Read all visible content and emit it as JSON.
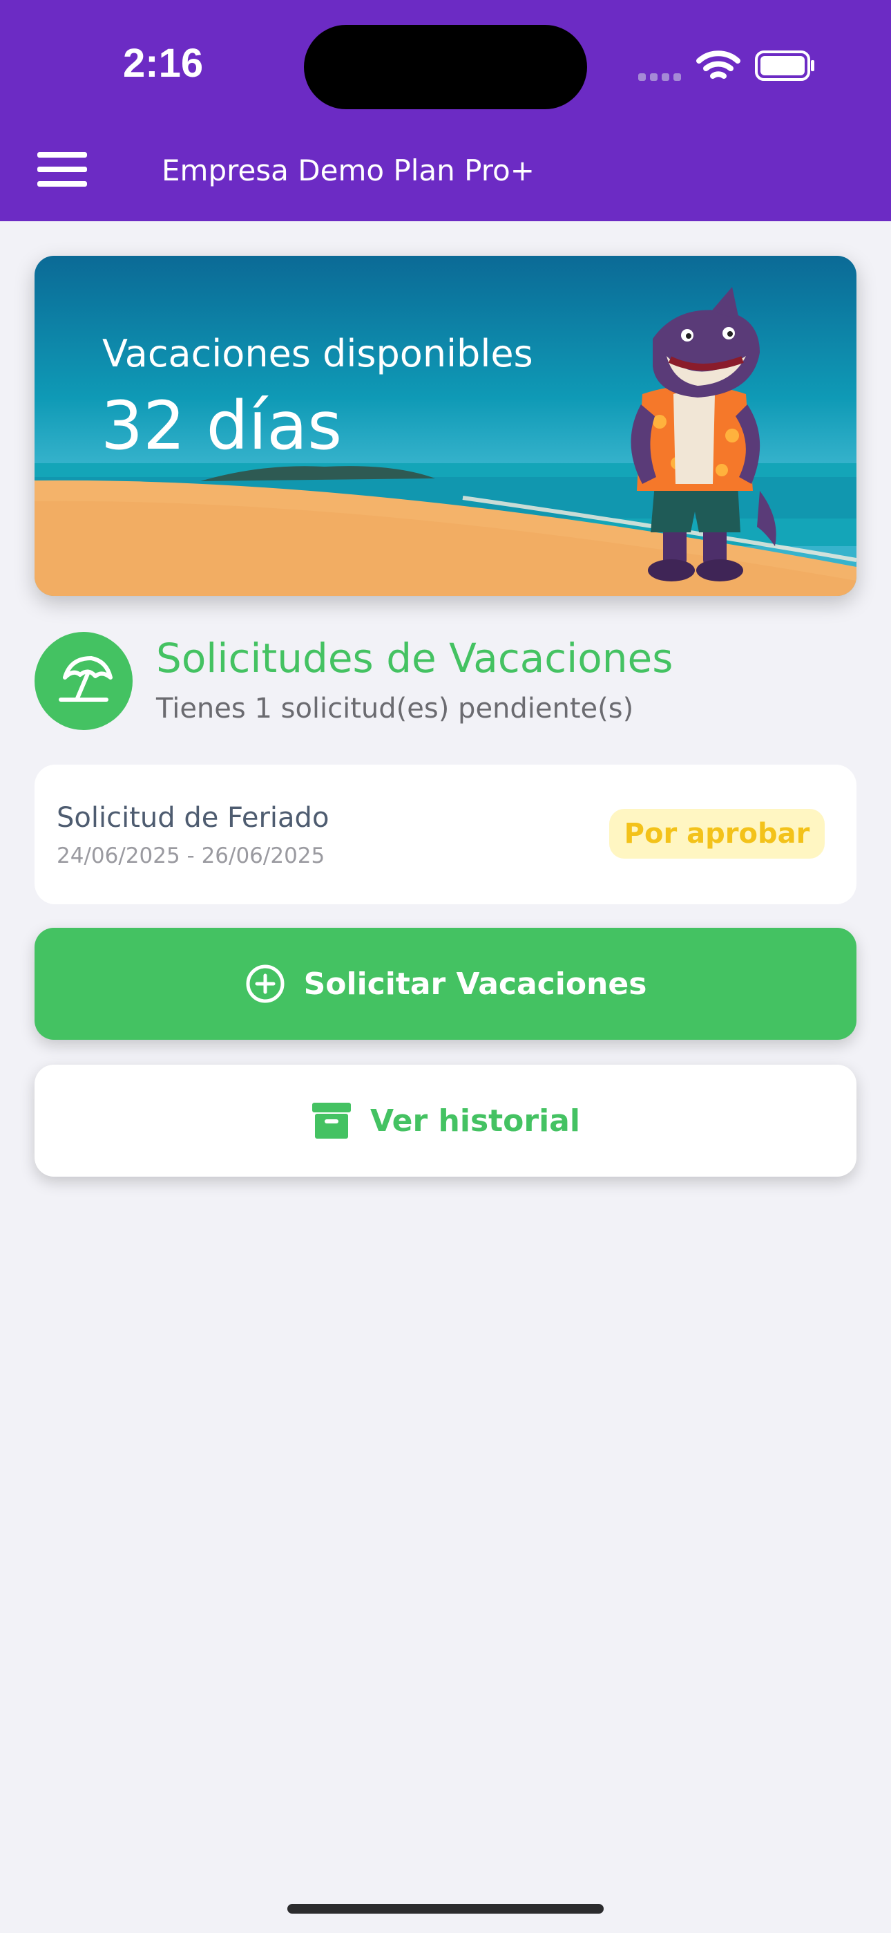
{
  "status_bar": {
    "time": "2:16",
    "icons": [
      "signal-icon",
      "wifi-icon",
      "battery-icon"
    ]
  },
  "header": {
    "menu_icon": "hamburger-menu-icon",
    "title": "Empresa Demo Plan Pro+",
    "background_color": "#6c2bc4"
  },
  "hero": {
    "label": "Vacaciones disponibles",
    "value": "32 días",
    "image": "beach-with-shark-mascot-illustration"
  },
  "section": {
    "icon": "beach-umbrella-icon",
    "title": "Solicitudes de Vacaciones",
    "subtitle": "Tienes 1 solicitud(es) pendiente(s)"
  },
  "requests": [
    {
      "title": "Solicitud de Feriado",
      "dates": "24/06/2025 - 26/06/2025",
      "status": "Por aprobar"
    }
  ],
  "actions": {
    "request_label": "Solicitar Vacaciones",
    "request_icon": "plus-circle-icon",
    "history_label": "Ver historial",
    "history_icon": "archive-box-icon"
  },
  "colors": {
    "accent_green": "#44c262",
    "pending_badge_bg": "#fff6c2",
    "pending_badge_text": "#f3c21a",
    "page_background": "#f2f2f7"
  }
}
